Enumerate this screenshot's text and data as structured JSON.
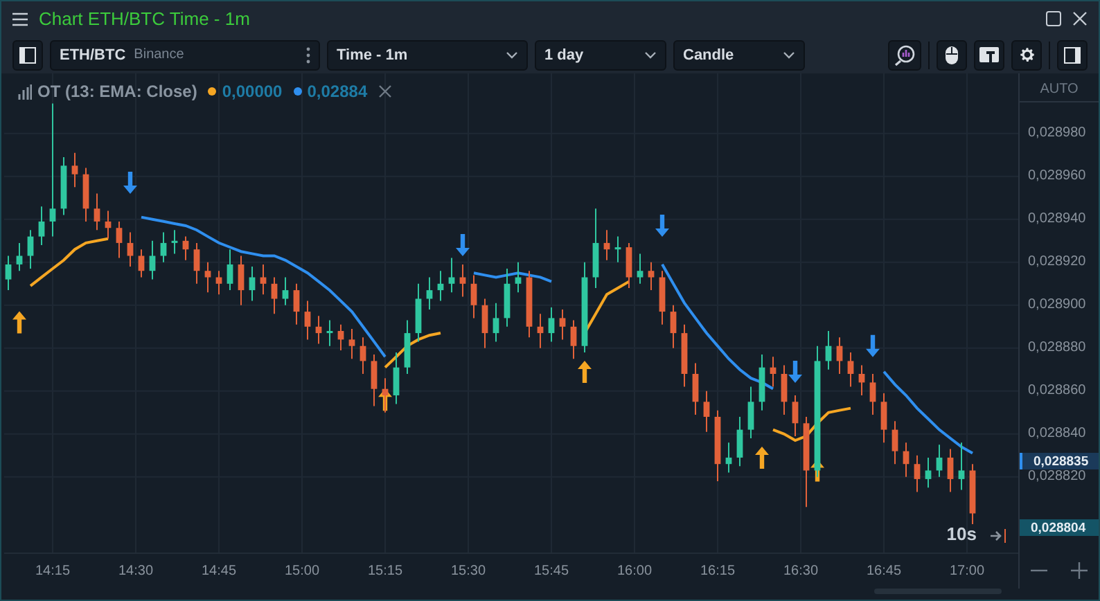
{
  "window": {
    "title": "Chart ETH/BTC Time - 1m"
  },
  "toolbar": {
    "symbol": "ETH/BTC",
    "exchange": "Binance",
    "interval": "Time - 1m",
    "range": "1 day",
    "chart_type": "Candle"
  },
  "legend": {
    "indicator": "OT (13: EMA: Close)",
    "values": [
      {
        "text": "0,00000",
        "color": "#f5a623"
      },
      {
        "text": "0,02884",
        "color": "#2f8fef"
      }
    ]
  },
  "price_axis": {
    "mode": "AUTO",
    "labels": [
      {
        "text": "0,028835",
        "kind": "ema"
      },
      {
        "text": "0,028804",
        "kind": "last"
      }
    ]
  },
  "countdown": "10s",
  "chart_data": {
    "type": "candlestick",
    "xlim": [
      846.25,
      1029.25
    ],
    "ylim": [
      0.028768,
      0.029008
    ],
    "grid": true,
    "x": [
      847,
      849,
      851,
      853,
      855,
      857,
      859,
      861,
      863,
      865,
      867,
      869,
      871,
      873,
      875,
      877,
      879,
      881,
      883,
      885,
      887,
      889,
      891,
      893,
      895,
      897,
      899,
      901,
      903,
      905,
      907,
      909,
      911,
      913,
      915,
      917,
      919,
      921,
      923,
      925,
      927,
      929,
      931,
      933,
      935,
      937,
      939,
      941,
      943,
      945,
      947,
      949,
      951,
      953,
      955,
      957,
      959,
      961,
      963,
      965,
      967,
      969,
      971,
      973,
      975,
      977,
      979,
      981,
      983,
      985,
      987,
      989,
      991,
      993,
      995,
      997,
      999,
      1001,
      1003,
      1005,
      1007,
      1009,
      1011,
      1013,
      1015,
      1017,
      1019,
      1021
    ],
    "xticks": [
      {
        "value": 855,
        "label": "14:15"
      },
      {
        "value": 870,
        "label": "14:30"
      },
      {
        "value": 885,
        "label": "14:45"
      },
      {
        "value": 900,
        "label": "15:00"
      },
      {
        "value": 915,
        "label": "15:15"
      },
      {
        "value": 930,
        "label": "15:30"
      },
      {
        "value": 945,
        "label": "15:45"
      },
      {
        "value": 960,
        "label": "16:00"
      },
      {
        "value": 975,
        "label": "16:15"
      },
      {
        "value": 990,
        "label": "16:30"
      },
      {
        "value": 1005,
        "label": "16:45"
      },
      {
        "value": 1020,
        "label": "17:00"
      }
    ],
    "yticks": [
      {
        "value": 0.02882,
        "label": "0,028820"
      },
      {
        "value": 0.02884,
        "label": "0,028840"
      },
      {
        "value": 0.02886,
        "label": "0,028860"
      },
      {
        "value": 0.02888,
        "label": "0,028880"
      },
      {
        "value": 0.0289,
        "label": "0,028900"
      },
      {
        "value": 0.02892,
        "label": "0,028920"
      },
      {
        "value": 0.02894,
        "label": "0,028940"
      },
      {
        "value": 0.02896,
        "label": "0,028960"
      },
      {
        "value": 0.02898,
        "label": "0,028980"
      }
    ],
    "ohlc": [
      [
        0.028912,
        0.028923,
        0.028907,
        0.028919
      ],
      [
        0.028919,
        0.028929,
        0.028916,
        0.028923
      ],
      [
        0.028923,
        0.028935,
        0.028917,
        0.028932
      ],
      [
        0.028932,
        0.028946,
        0.028928,
        0.028939
      ],
      [
        0.028939,
        0.028994,
        0.028932,
        0.028945
      ],
      [
        0.028945,
        0.028969,
        0.028942,
        0.028965
      ],
      [
        0.028965,
        0.028971,
        0.028955,
        0.028961
      ],
      [
        0.028961,
        0.028964,
        0.028939,
        0.028945
      ],
      [
        0.028945,
        0.028952,
        0.028935,
        0.028939
      ],
      [
        0.028939,
        0.028944,
        0.028931,
        0.028936
      ],
      [
        0.028936,
        0.028939,
        0.028922,
        0.028929
      ],
      [
        0.028929,
        0.028934,
        0.028918,
        0.028923
      ],
      [
        0.028923,
        0.028926,
        0.028913,
        0.028916
      ],
      [
        0.028916,
        0.02893,
        0.028912,
        0.028923
      ],
      [
        0.028923,
        0.028934,
        0.02892,
        0.028929
      ],
      [
        0.028929,
        0.028935,
        0.028924,
        0.02893
      ],
      [
        0.02893,
        0.028932,
        0.028921,
        0.028926
      ],
      [
        0.028926,
        0.028929,
        0.02891,
        0.028916
      ],
      [
        0.028916,
        0.02892,
        0.028906,
        0.028913
      ],
      [
        0.028913,
        0.028916,
        0.028905,
        0.02891
      ],
      [
        0.02891,
        0.028926,
        0.028907,
        0.028919
      ],
      [
        0.028919,
        0.028923,
        0.0289,
        0.028907
      ],
      [
        0.028907,
        0.028918,
        0.028902,
        0.028913
      ],
      [
        0.028913,
        0.028919,
        0.028905,
        0.02891
      ],
      [
        0.02891,
        0.028913,
        0.028896,
        0.028903
      ],
      [
        0.028903,
        0.028913,
        0.0289,
        0.028907
      ],
      [
        0.028907,
        0.02891,
        0.028891,
        0.028897
      ],
      [
        0.028897,
        0.028902,
        0.028884,
        0.02889
      ],
      [
        0.02889,
        0.028895,
        0.028882,
        0.028887
      ],
      [
        0.028887,
        0.028893,
        0.028881,
        0.028888
      ],
      [
        0.028888,
        0.028891,
        0.028879,
        0.028884
      ],
      [
        0.028884,
        0.028889,
        0.028875,
        0.028881
      ],
      [
        0.028881,
        0.028885,
        0.028868,
        0.028874
      ],
      [
        0.028874,
        0.028877,
        0.028853,
        0.028861
      ],
      [
        0.028861,
        0.028866,
        0.02885,
        0.028858
      ],
      [
        0.028858,
        0.028878,
        0.028854,
        0.028871
      ],
      [
        0.028871,
        0.028893,
        0.028868,
        0.028887
      ],
      [
        0.028887,
        0.02891,
        0.028883,
        0.028903
      ],
      [
        0.028903,
        0.028913,
        0.028898,
        0.028907
      ],
      [
        0.028907,
        0.028916,
        0.028902,
        0.02891
      ],
      [
        0.02891,
        0.028922,
        0.028906,
        0.028913
      ],
      [
        0.028913,
        0.028919,
        0.028904,
        0.02891
      ],
      [
        0.02891,
        0.028914,
        0.028894,
        0.0289
      ],
      [
        0.0289,
        0.028903,
        0.02888,
        0.028887
      ],
      [
        0.028887,
        0.028901,
        0.028883,
        0.028894
      ],
      [
        0.028894,
        0.028917,
        0.02889,
        0.02891
      ],
      [
        0.02891,
        0.02892,
        0.028906,
        0.028913
      ],
      [
        0.028913,
        0.028916,
        0.028885,
        0.02889
      ],
      [
        0.02889,
        0.028896,
        0.02888,
        0.028887
      ],
      [
        0.028887,
        0.028899,
        0.028883,
        0.028894
      ],
      [
        0.028894,
        0.028898,
        0.028884,
        0.02889
      ],
      [
        0.02889,
        0.028893,
        0.028875,
        0.028881
      ],
      [
        0.028881,
        0.02892,
        0.028878,
        0.028913
      ],
      [
        0.028913,
        0.028945,
        0.028908,
        0.028929
      ],
      [
        0.028929,
        0.028935,
        0.028921,
        0.028926
      ],
      [
        0.028926,
        0.028932,
        0.02892,
        0.028927
      ],
      [
        0.028927,
        0.028929,
        0.028908,
        0.028913
      ],
      [
        0.028913,
        0.028924,
        0.02891,
        0.028916
      ],
      [
        0.028916,
        0.02892,
        0.028907,
        0.028913
      ],
      [
        0.028913,
        0.028916,
        0.028891,
        0.028897
      ],
      [
        0.028897,
        0.0289,
        0.02888,
        0.028887
      ],
      [
        0.028887,
        0.028891,
        0.028862,
        0.028868
      ],
      [
        0.028868,
        0.028873,
        0.028849,
        0.028855
      ],
      [
        0.028855,
        0.02886,
        0.028841,
        0.028848
      ],
      [
        0.028848,
        0.028851,
        0.028818,
        0.028826
      ],
      [
        0.028826,
        0.028836,
        0.028822,
        0.028829
      ],
      [
        0.028829,
        0.028848,
        0.028825,
        0.028842
      ],
      [
        0.028842,
        0.028862,
        0.028838,
        0.028855
      ],
      [
        0.028855,
        0.028877,
        0.028851,
        0.028871
      ],
      [
        0.028871,
        0.028876,
        0.028862,
        0.028868
      ],
      [
        0.028868,
        0.028872,
        0.028849,
        0.028855
      ],
      [
        0.028855,
        0.028858,
        0.028839,
        0.028845
      ],
      [
        0.028845,
        0.028848,
        0.028806,
        0.028823
      ],
      [
        0.028823,
        0.028881,
        0.02882,
        0.028874
      ],
      [
        0.028874,
        0.028888,
        0.02887,
        0.028881
      ],
      [
        0.028881,
        0.028885,
        0.028868,
        0.028874
      ],
      [
        0.028874,
        0.028878,
        0.028862,
        0.028868
      ],
      [
        0.028868,
        0.028872,
        0.028858,
        0.028864
      ],
      [
        0.028864,
        0.028868,
        0.028849,
        0.028855
      ],
      [
        0.028855,
        0.028859,
        0.028836,
        0.028842
      ],
      [
        0.028842,
        0.028846,
        0.028826,
        0.028832
      ],
      [
        0.028832,
        0.028836,
        0.02882,
        0.028826
      ],
      [
        0.028826,
        0.02883,
        0.028813,
        0.028819
      ],
      [
        0.028819,
        0.028829,
        0.028815,
        0.028823
      ],
      [
        0.028823,
        0.028835,
        0.02882,
        0.028829
      ],
      [
        0.028829,
        0.028833,
        0.028813,
        0.028819
      ],
      [
        0.028819,
        0.028836,
        0.028814,
        0.028823
      ],
      [
        0.028823,
        0.028826,
        0.028798,
        0.028803
      ]
    ],
    "series": [
      {
        "type": "line",
        "color": "#f5a623",
        "values": [
          null,
          null,
          0.028909,
          0.028913,
          0.028917,
          0.028921,
          0.028926,
          0.028929,
          0.02893,
          0.028931,
          null,
          null,
          null,
          null,
          null,
          null,
          null,
          null,
          null,
          null,
          null,
          null,
          null,
          null,
          null,
          null,
          null,
          null,
          null,
          null,
          null,
          null,
          null,
          null,
          0.028871,
          0.028876,
          0.028881,
          0.028884,
          0.028886,
          0.028887,
          null,
          null,
          null,
          null,
          null,
          null,
          null,
          null,
          null,
          null,
          null,
          null,
          0.028887,
          0.028896,
          0.028905,
          0.028908,
          0.028911,
          null,
          null,
          null,
          null,
          null,
          null,
          null,
          null,
          null,
          null,
          null,
          null,
          0.028842,
          0.02884,
          0.028837,
          0.028839,
          0.028845,
          0.02885,
          0.028851,
          0.028852,
          null,
          null,
          null,
          null,
          null,
          null,
          null,
          null,
          null,
          null,
          null
        ]
      },
      {
        "type": "line",
        "color": "#2f8fef",
        "values": [
          null,
          null,
          null,
          null,
          null,
          null,
          null,
          null,
          null,
          null,
          null,
          null,
          0.028941,
          0.02894,
          0.028939,
          0.028938,
          0.028937,
          0.028935,
          0.028932,
          0.028929,
          0.028927,
          0.028925,
          0.028924,
          0.028923,
          0.028923,
          0.028921,
          0.028918,
          0.028915,
          0.028911,
          0.028907,
          0.028902,
          0.028897,
          0.02889,
          0.028883,
          0.028876,
          null,
          null,
          null,
          null,
          null,
          null,
          null,
          0.028915,
          0.028914,
          0.028913,
          0.028914,
          0.028915,
          0.028914,
          0.028913,
          0.028911,
          null,
          null,
          null,
          null,
          null,
          null,
          null,
          null,
          null,
          0.028919,
          0.02891,
          0.028901,
          0.028894,
          0.028887,
          0.028881,
          0.028875,
          0.02887,
          0.028866,
          0.028864,
          0.028861,
          null,
          null,
          null,
          null,
          null,
          null,
          null,
          null,
          null,
          0.028869,
          0.028863,
          0.028858,
          0.028852,
          0.028847,
          0.028842,
          0.028838,
          0.028834,
          0.028831
        ]
      },
      {
        "type": "scatter",
        "color": "#f5a623",
        "values": [
          null,
          0.028892,
          null,
          null,
          null,
          null,
          null,
          null,
          null,
          null,
          null,
          null,
          null,
          null,
          null,
          null,
          null,
          null,
          null,
          null,
          null,
          null,
          null,
          null,
          null,
          null,
          null,
          null,
          null,
          null,
          null,
          null,
          null,
          null,
          0.028856,
          null,
          null,
          null,
          null,
          null,
          null,
          null,
          null,
          null,
          null,
          null,
          null,
          null,
          null,
          null,
          null,
          null,
          0.028869,
          null,
          null,
          null,
          null,
          null,
          null,
          null,
          null,
          null,
          null,
          null,
          null,
          null,
          null,
          null,
          0.028829,
          null,
          null,
          null,
          null,
          0.028823,
          null,
          null,
          null,
          null,
          null,
          null,
          null,
          null,
          null,
          null,
          null,
          null,
          null,
          null
        ]
      },
      {
        "type": "scatter",
        "color": "#2f8fef",
        "values": [
          null,
          null,
          null,
          null,
          null,
          null,
          null,
          null,
          null,
          null,
          null,
          0.028957,
          null,
          null,
          null,
          null,
          null,
          null,
          null,
          null,
          null,
          null,
          null,
          null,
          null,
          null,
          null,
          null,
          null,
          null,
          null,
          null,
          null,
          null,
          null,
          null,
          null,
          null,
          null,
          null,
          null,
          0.028928,
          null,
          null,
          null,
          null,
          null,
          null,
          null,
          null,
          null,
          null,
          null,
          null,
          null,
          null,
          null,
          null,
          null,
          0.028937,
          null,
          null,
          null,
          null,
          null,
          null,
          null,
          null,
          null,
          null,
          null,
          0.028869,
          null,
          null,
          null,
          null,
          null,
          null,
          0.028881,
          null,
          null,
          null,
          null,
          null,
          null,
          null,
          null,
          null
        ]
      }
    ]
  }
}
